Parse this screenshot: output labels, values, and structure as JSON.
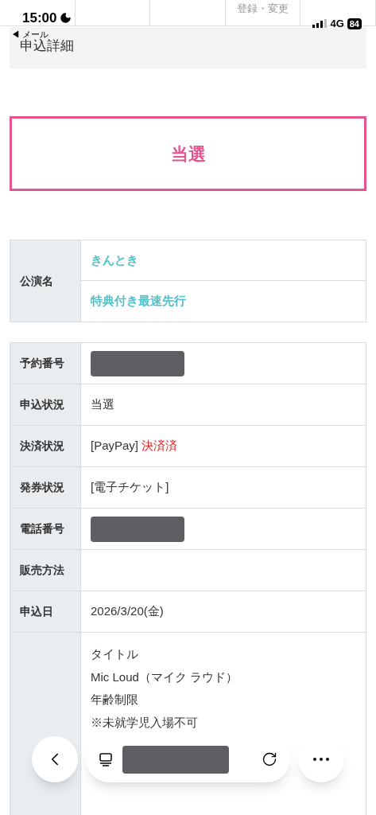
{
  "status_bar": {
    "time": "15:00",
    "network": "4G",
    "battery": "84"
  },
  "nav_tab": "登録・変更",
  "back_link": "◀ メール",
  "page_title": "申込詳細",
  "result": "当選",
  "performance": {
    "label": "公演名",
    "values": [
      "きんとき",
      "特典付き最速先行"
    ]
  },
  "details": [
    {
      "label": "予約番号",
      "kind": "redacted"
    },
    {
      "label": "申込状況",
      "kind": "text",
      "value": "当選"
    },
    {
      "label": "決済状況",
      "kind": "payment",
      "value": "[PayPay]",
      "status": "決済済"
    },
    {
      "label": "発券状況",
      "kind": "text",
      "value": "[電子チケット]"
    },
    {
      "label": "電話番号",
      "kind": "redacted"
    },
    {
      "label": "販売方法",
      "kind": "text"
    },
    {
      "label": "申込日",
      "kind": "text",
      "value": "2026/3/20(金)"
    },
    {
      "kind": "lines",
      "lines": [
        "タイトル",
        "Mic Loud（マイク ラウド）",
        "年齢制限",
        "※未就学児入場不可"
      ]
    }
  ]
}
